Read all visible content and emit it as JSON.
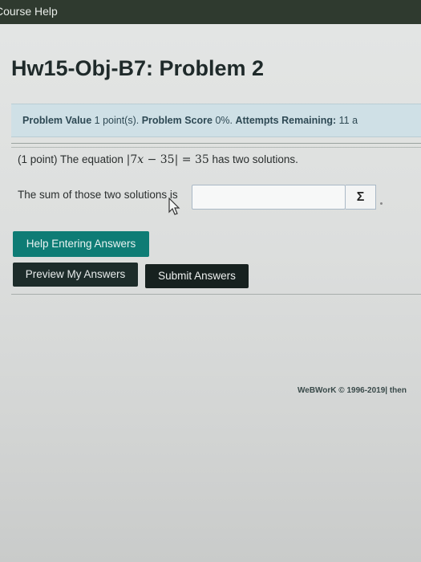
{
  "topbar": {
    "course_help": "Course Help"
  },
  "title": "Hw15-Obj-B7: Problem 2",
  "info": {
    "value_label": "Problem Value",
    "value": "1 point(s).",
    "score_label": "Problem Score",
    "score": "0%.",
    "attempts_label": "Attempts Remaining:",
    "attempts": "11 a"
  },
  "problem": {
    "intro": "(1 point) The equation",
    "math_lhs_open": "|7",
    "math_var": "x",
    "math_lhs_rest": " − 35|",
    "math_eq": " = 35",
    "outro": "has two solutions.",
    "sum_prompt": "The sum of those two solutions is",
    "answer_value": "",
    "sigma": "Σ"
  },
  "buttons": {
    "help": "Help Entering Answers",
    "preview": "Preview My Answers",
    "submit": "Submit Answers"
  },
  "footer": {
    "text": "WeBWorK © 1996-2019| then"
  },
  "colors": {
    "topbar": "#2f3a2f",
    "info_bar": "#cfe0e6",
    "help_button": "#0e7c75",
    "dark_button": "#1d2c2a"
  }
}
